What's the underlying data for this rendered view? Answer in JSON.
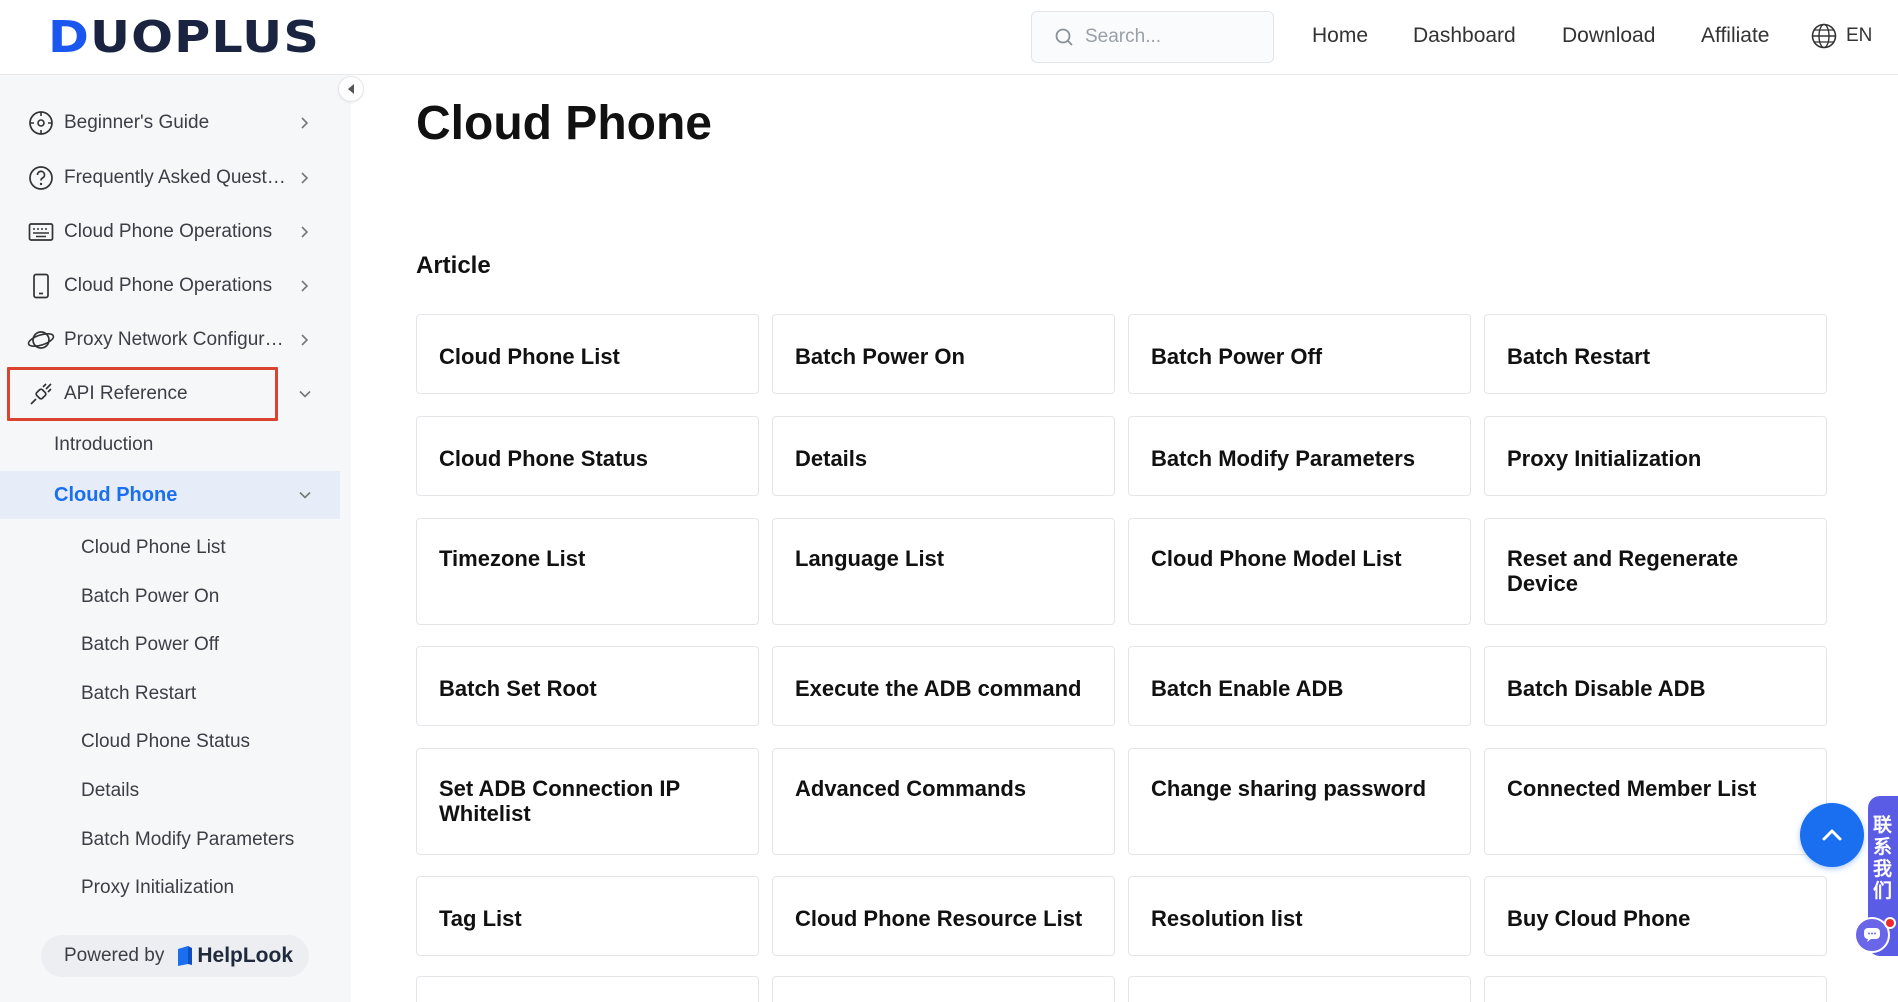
{
  "header": {
    "logo_text_first": "D",
    "logo_text_rest": "UOPLUS",
    "search_placeholder": "Search...",
    "nav": [
      "Home",
      "Dashboard",
      "Download",
      "Affiliate"
    ],
    "language": "EN"
  },
  "sidebar": {
    "items": [
      {
        "label": "Beginner's Guide",
        "icon": "compass-icon"
      },
      {
        "label": "Frequently Asked Questions",
        "icon": "question-circle-icon"
      },
      {
        "label": "Cloud Phone Operations",
        "icon": "keyboard-icon"
      },
      {
        "label": "Cloud Phone Operations",
        "icon": "phone-icon"
      },
      {
        "label": "Proxy Network Configuration",
        "icon": "planet-icon"
      },
      {
        "label": "API Reference",
        "icon": "plug-icon"
      }
    ],
    "sub_items": [
      "Introduction",
      "Cloud Phone"
    ],
    "leaves": [
      "Cloud Phone List",
      "Batch Power On",
      "Batch Power Off",
      "Batch Restart",
      "Cloud Phone Status",
      "Details",
      "Batch Modify Parameters",
      "Proxy Initialization"
    ],
    "powered_by": "Powered by",
    "powered_brand": "HelpLook"
  },
  "main": {
    "title": "Cloud Phone",
    "section": "Article",
    "cards": [
      "Cloud Phone List",
      "Batch Power On",
      "Batch Power Off",
      "Batch Restart",
      "Cloud Phone Status",
      "Details",
      "Batch Modify Parameters",
      "Proxy Initialization",
      "Timezone List",
      "Language List",
      "Cloud Phone Model List",
      "Reset and Regenerate Device",
      "Batch Set Root",
      "Execute the ADB command",
      "Batch Enable ADB",
      "Batch Disable ADB",
      "Set ADB Connection IP Whitelist",
      "Advanced Commands",
      "Change sharing password",
      "Connected Member List",
      "Tag List",
      "Cloud Phone Resource List",
      "Resolution list",
      "Buy Cloud Phone"
    ]
  },
  "floating": {
    "contact_text": "联系我们"
  },
  "colors": {
    "accent": "#1a6ff0",
    "highlight_border": "#d9432f",
    "contact_bg": "#5b5ce6"
  }
}
